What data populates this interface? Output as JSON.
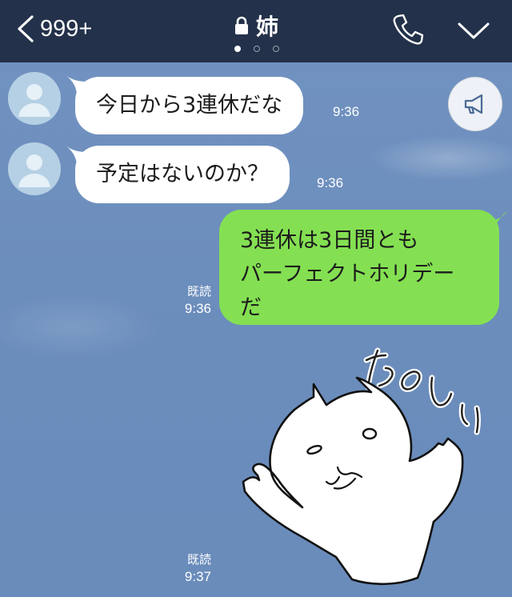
{
  "header": {
    "back_count": "999+",
    "title": "姉",
    "page_dots": 3,
    "active_dot": 0,
    "icons": [
      "back-chevron-icon",
      "lock-icon",
      "phone-icon",
      "chevron-down-icon"
    ],
    "background_color": "#23314a"
  },
  "chat": {
    "background_color": "#6e8fbd",
    "messages": [
      {
        "direction": "in",
        "text": "今日から3連休だな",
        "time": "9:36"
      },
      {
        "direction": "in",
        "text": "予定はないのか？",
        "time": "9:36"
      },
      {
        "direction": "out",
        "lines": [
          "3連休は3日間とも",
          "パーフェクトホリデー",
          "だ"
        ],
        "read": "既読",
        "time": "9:36"
      },
      {
        "direction": "out",
        "type": "sticker",
        "sticker_text": "たのしい",
        "read": "既読",
        "time": "9:37"
      }
    ],
    "announce_icon": "megaphone-icon",
    "colors": {
      "incoming_bubble": "#ffffff",
      "outgoing_bubble": "#84e052",
      "avatar": "#b5d0e4"
    }
  }
}
